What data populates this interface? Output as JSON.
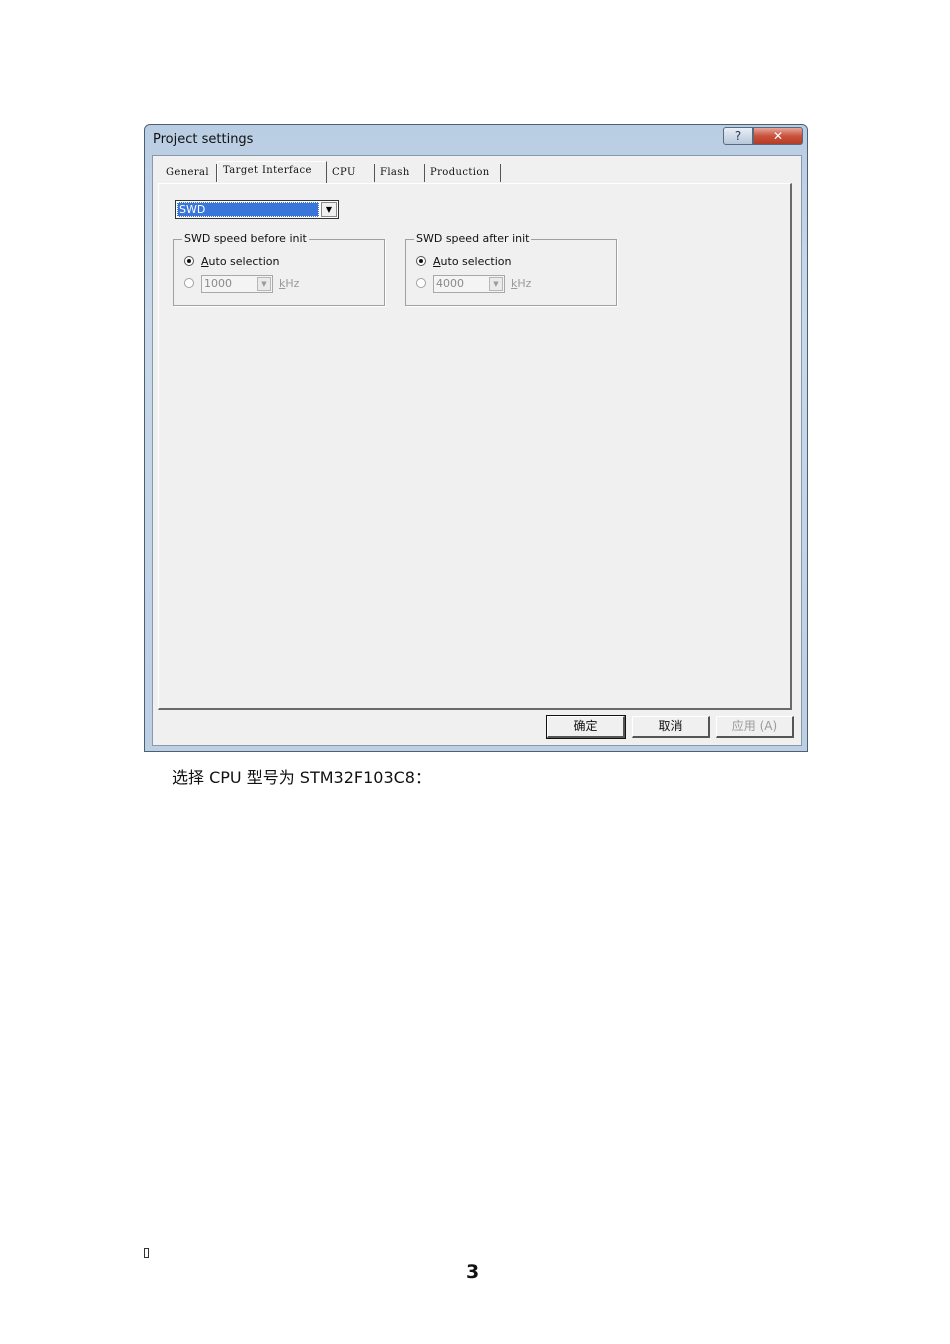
{
  "window": {
    "title": "Project settings",
    "help_label": "?",
    "close_label": "✕"
  },
  "tabs": [
    {
      "label": "General"
    },
    {
      "label": "Target Interface"
    },
    {
      "label": "CPU"
    },
    {
      "label": "Flash"
    },
    {
      "label": "Production"
    }
  ],
  "active_tab": "Target Interface",
  "interface_select": {
    "value": "SWD",
    "arrow": "▼"
  },
  "group_before": {
    "title": "SWD speed before init",
    "auto_label_first": "A",
    "auto_label_rest": "uto selection",
    "speed_value": "1000",
    "unit_first": "k",
    "unit_rest": "Hz",
    "arrow": "▼"
  },
  "group_after": {
    "title": "SWD speed after init",
    "auto_label_first": "A",
    "auto_label_rest": "uto selection",
    "speed_value": "4000",
    "unit_first": "k",
    "unit_rest": "Hz",
    "arrow": "▼"
  },
  "buttons": {
    "ok": "确定",
    "cancel": "取消",
    "apply": "应用 (A)"
  },
  "document": {
    "caption": "选择 CPU 型号为 STM32F103C8：",
    "page_number": "3"
  }
}
